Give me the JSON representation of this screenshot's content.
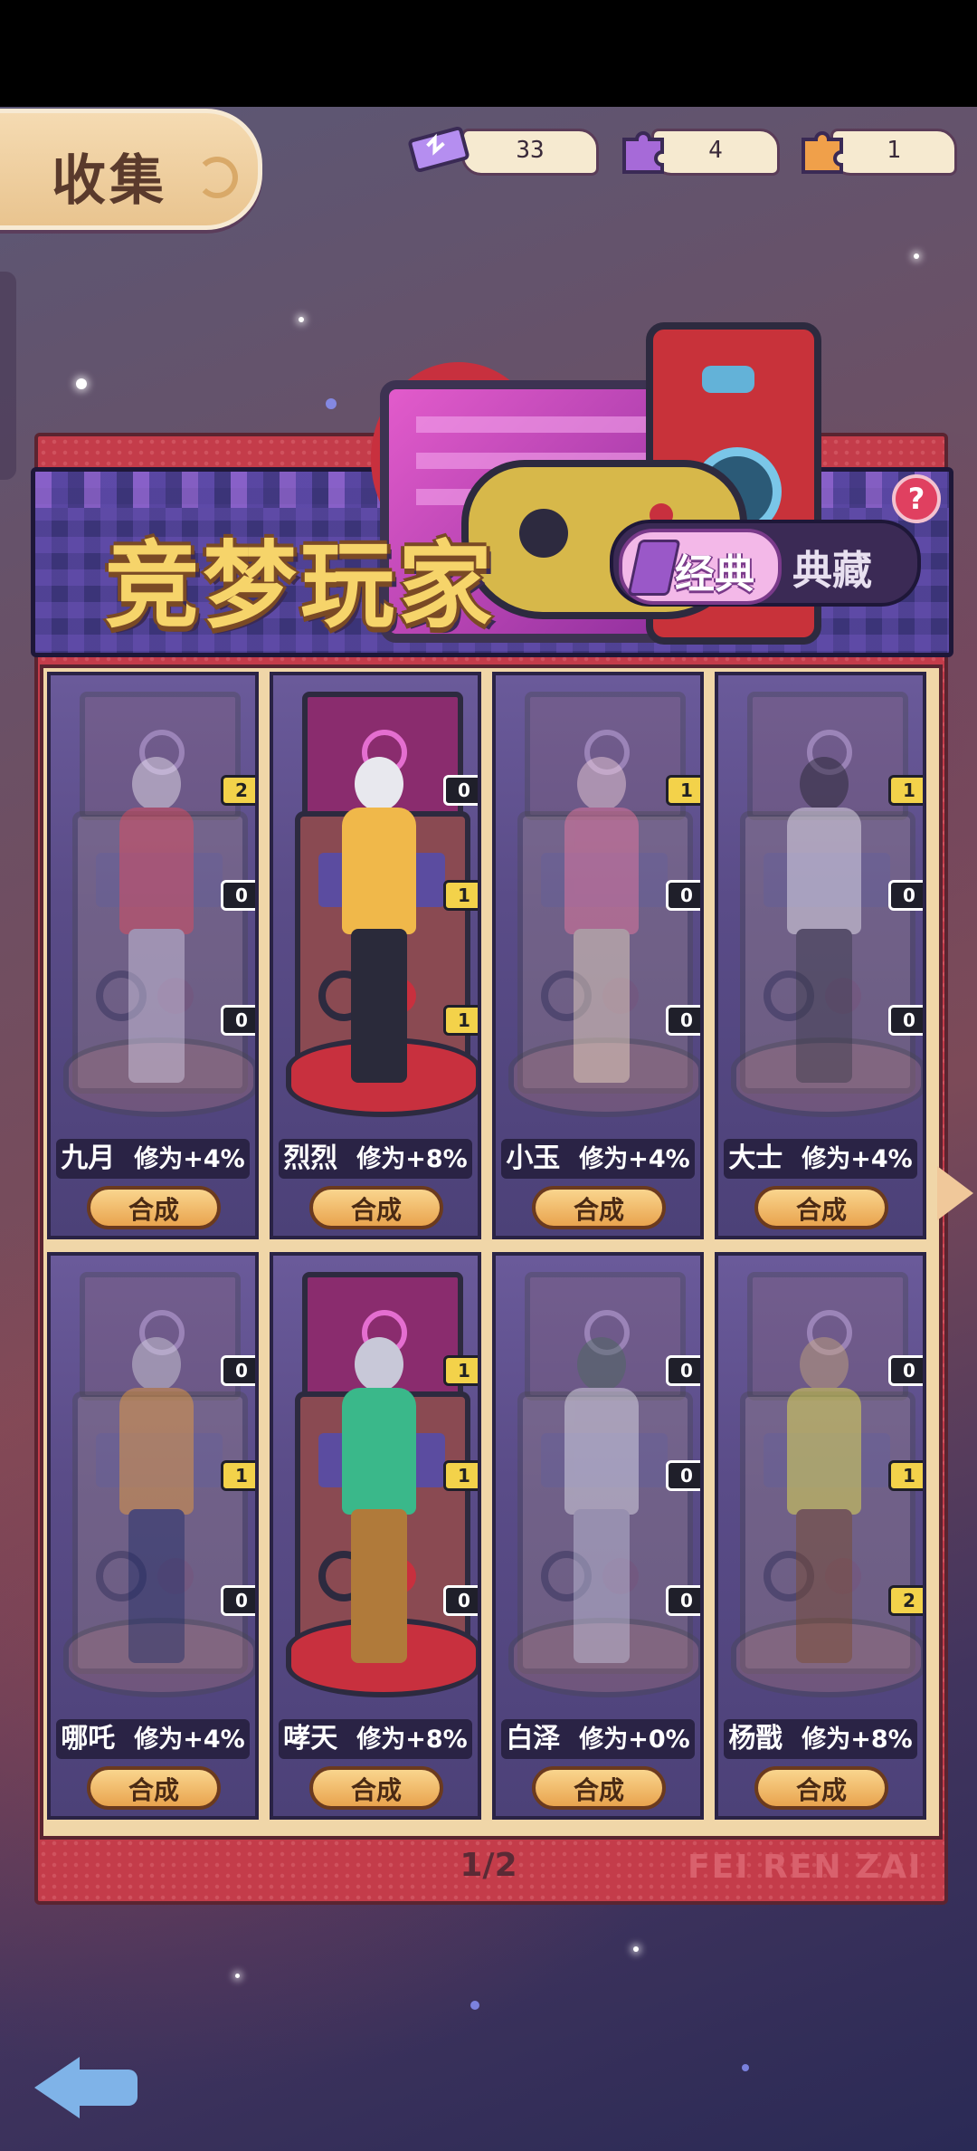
{
  "header": {
    "title": "收集"
  },
  "currency": [
    {
      "icon": "ticket-icon",
      "value": "33"
    },
    {
      "icon": "purple-puzzle-icon",
      "value": "4"
    },
    {
      "icon": "orange-puzzle-icon",
      "value": "1"
    }
  ],
  "banner": {
    "title": "竞梦玩家",
    "tab_active": "经典",
    "tab_inactive": "典藏",
    "help": "?"
  },
  "cards": [
    {
      "name": "九月",
      "bonus": "修为+4%",
      "badges": [
        "2",
        "0",
        "0"
      ],
      "owned": true
    },
    {
      "name": "烈烈",
      "bonus": "修为+8%",
      "badges": [
        "0",
        "1",
        "1"
      ],
      "owned": true
    },
    {
      "name": "小玉",
      "bonus": "修为+4%",
      "badges": [
        "1",
        "0",
        "0"
      ],
      "owned": true
    },
    {
      "name": "大士",
      "bonus": "修为+4%",
      "badges": [
        "1",
        "0",
        "0"
      ],
      "owned": true
    },
    {
      "name": "哪吒",
      "bonus": "修为+4%",
      "badges": [
        "0",
        "1",
        "0"
      ],
      "owned": true
    },
    {
      "name": "哮天",
      "bonus": "修为+8%",
      "badges": [
        "1",
        "1",
        "0"
      ],
      "owned": true
    },
    {
      "name": "白泽",
      "bonus": "修为+0%",
      "badges": [
        "0",
        "0",
        "0"
      ],
      "owned": false
    },
    {
      "name": "杨戬",
      "bonus": "修为+8%",
      "badges": [
        "0",
        "1",
        "2"
      ],
      "owned": true
    }
  ],
  "merge_label": "合成",
  "pager": "1/2",
  "watermark": "FEI REN ZAI",
  "colors": {
    "accent": "#f3d24a",
    "panel": "#c43c4a",
    "button": "#e9a44e"
  }
}
